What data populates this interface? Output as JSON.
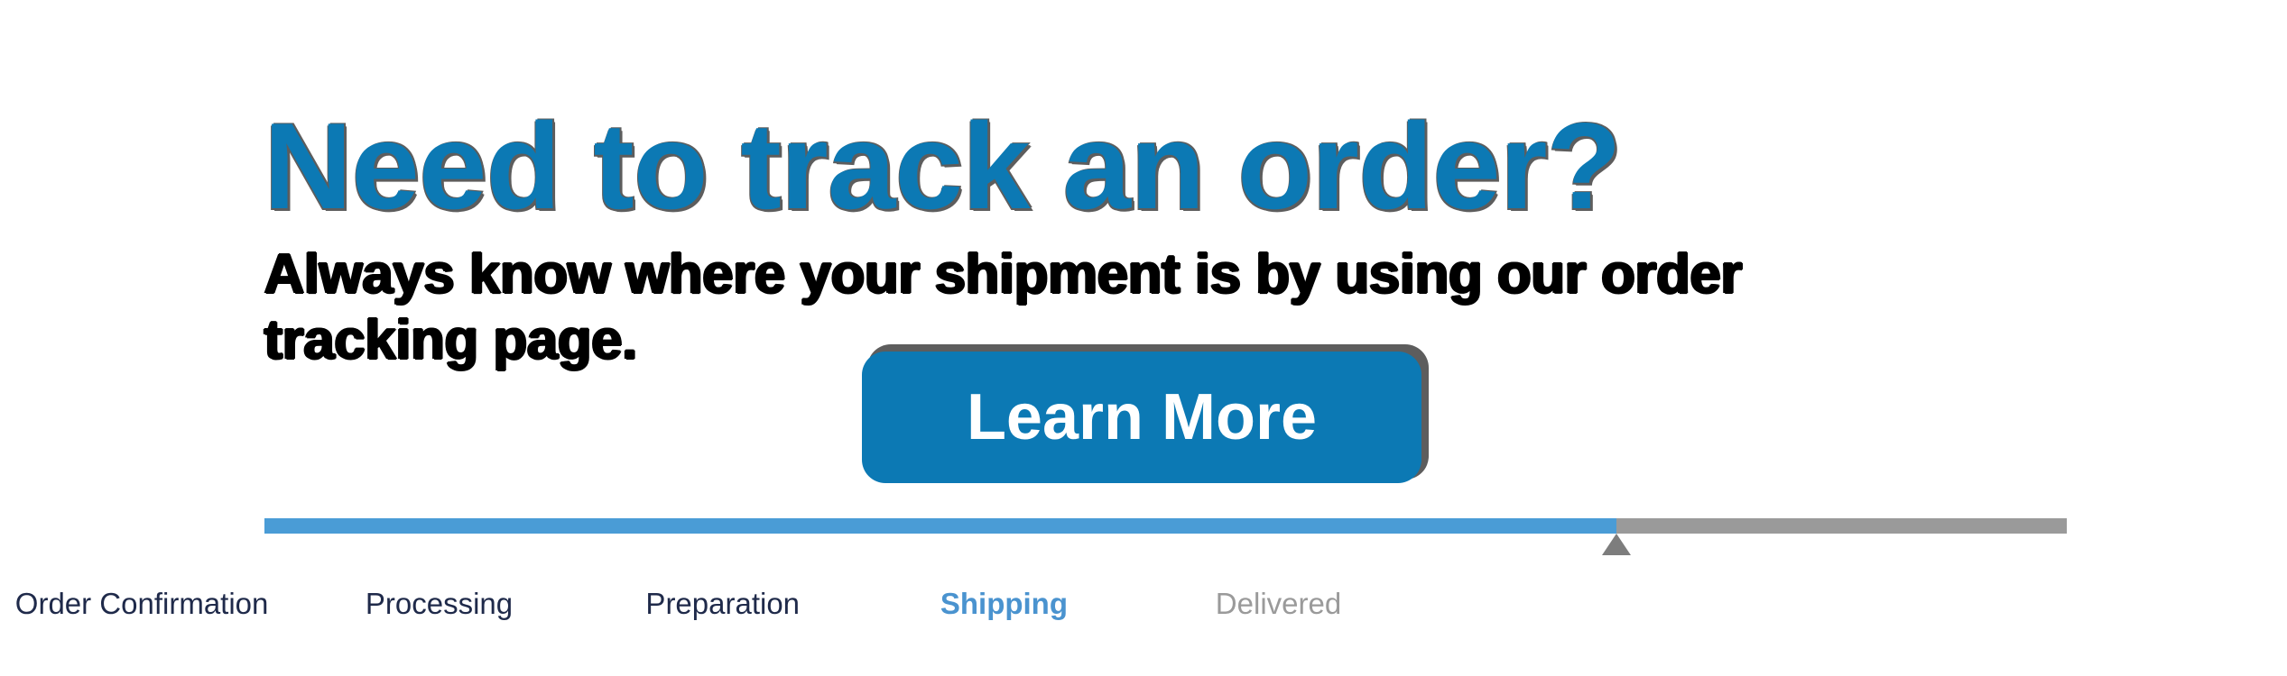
{
  "promo": {
    "headline": "Need to track an order?",
    "subheadline": "Always know where your shipment is by using our order tracking page.",
    "cta_label": "Learn More"
  },
  "colors": {
    "brand_blue": "#0c79b4",
    "track_blue": "#4a9cd6",
    "current_label_blue": "#4a93cf",
    "track_gray": "#9a9a9a",
    "marker_gray": "#7d7d7d",
    "label_navy": "#1f2a4a",
    "shadow_gray": "#5d5d5d",
    "background": "#ffffff"
  },
  "tracker": {
    "progress_percent": 75,
    "current_step_index": 3,
    "steps": [
      {
        "label": "Order Confirmation",
        "state": "complete",
        "position_percent": 6.2
      },
      {
        "label": "Processing",
        "state": "complete",
        "position_percent": 19.2
      },
      {
        "label": "Preparation",
        "state": "complete",
        "position_percent": 31.6
      },
      {
        "label": "Shipping",
        "state": "current",
        "position_percent": 43.9
      },
      {
        "label": "Delivered",
        "state": "future",
        "position_percent": 55.9
      }
    ]
  }
}
